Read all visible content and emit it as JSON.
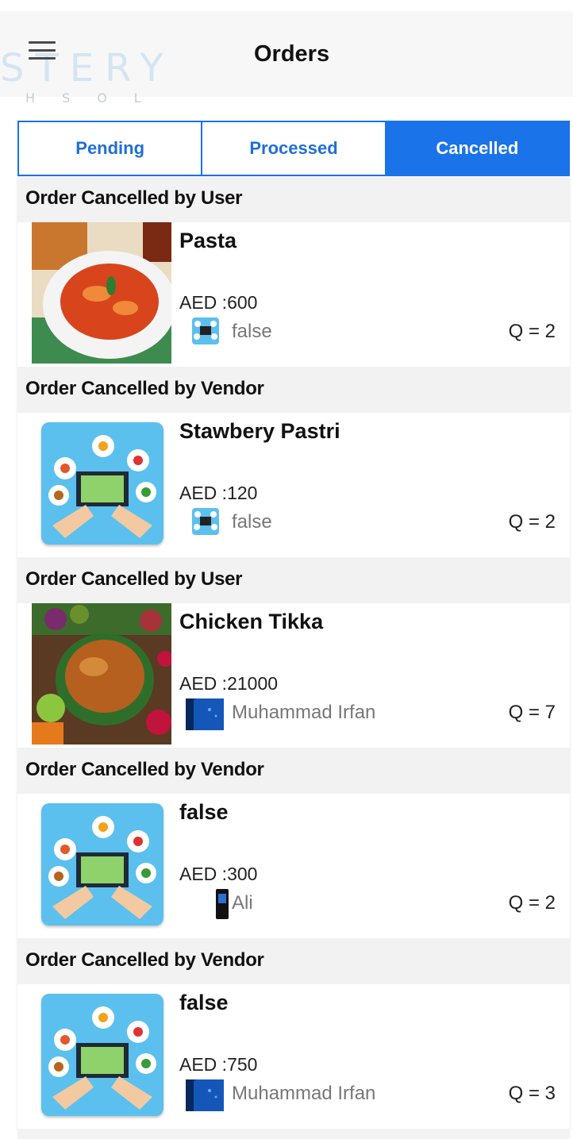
{
  "header": {
    "title": "Orders",
    "watermark": "STERY",
    "watermark_sub": "HSOL"
  },
  "tabs": [
    {
      "label": "Pending",
      "active": false
    },
    {
      "label": "Processed",
      "active": false
    },
    {
      "label": "Cancelled",
      "active": true
    }
  ],
  "colors": {
    "accent": "#1a73e8",
    "header_band": "#f2f2f2",
    "muted_text": "#777777"
  },
  "orders": [
    {
      "status": "Order Cancelled by User",
      "name": "Pasta",
      "price": "AED :600",
      "vendor": "false",
      "vendor_icon": "app-icon",
      "qty": "Q = 2",
      "thumb": "pasta-image"
    },
    {
      "status": "Order Cancelled by Vendor",
      "name": "Stawbery Pastri",
      "price": "AED :120",
      "vendor": "false",
      "vendor_icon": "app-icon",
      "qty": "Q = 2",
      "thumb": "food-app-image"
    },
    {
      "status": "Order Cancelled by User",
      "name": "Chicken Tikka",
      "price": "AED :21000",
      "vendor": "Muhammad Irfan",
      "vendor_icon": "profile-image",
      "qty": "Q = 7",
      "thumb": "chicken-image"
    },
    {
      "status": "Order Cancelled by Vendor",
      "name": "false",
      "price": "AED :300",
      "vendor": "Ali",
      "vendor_icon": "phone-image",
      "qty": "Q = 2",
      "thumb": "food-app-image"
    },
    {
      "status": "Order Cancelled by Vendor",
      "name": "false",
      "price": "AED :750",
      "vendor": "Muhammad Irfan",
      "vendor_icon": "profile-image",
      "qty": "Q = 3",
      "thumb": "food-app-image"
    }
  ]
}
